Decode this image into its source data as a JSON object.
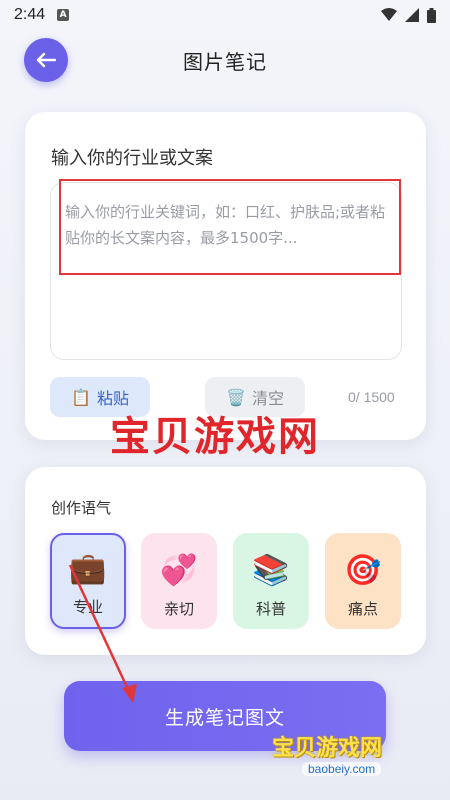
{
  "status_bar": {
    "time": "2:44",
    "notification_icon": "A"
  },
  "header": {
    "title": "图片笔记",
    "back_icon": "arrow-left-icon"
  },
  "input_card": {
    "title": "输入你的行业或文案",
    "placeholder": "输入你的行业关键词，如：口红、护肤品;或者粘贴你的长文案内容，最多1500字...",
    "paste_label": "粘贴",
    "paste_icon": "📋",
    "clear_label": "清空",
    "clear_icon": "🗑️",
    "char_count": "0/ 1500"
  },
  "watermark": {
    "center": "宝贝游戏网",
    "corner": "宝贝游戏网",
    "url": "baobeiy.com"
  },
  "tone_card": {
    "title": "创作语气",
    "options": [
      {
        "label": "专业",
        "icon": "💼",
        "selected": true
      },
      {
        "label": "亲切",
        "icon": "💞"
      },
      {
        "label": "科普",
        "icon": "📚"
      },
      {
        "label": "痛点",
        "icon": "🎯"
      }
    ]
  },
  "generate_button": {
    "label": "生成笔记图文"
  },
  "colors": {
    "accent": "#6b61e8",
    "highlight": "#e0373b"
  }
}
